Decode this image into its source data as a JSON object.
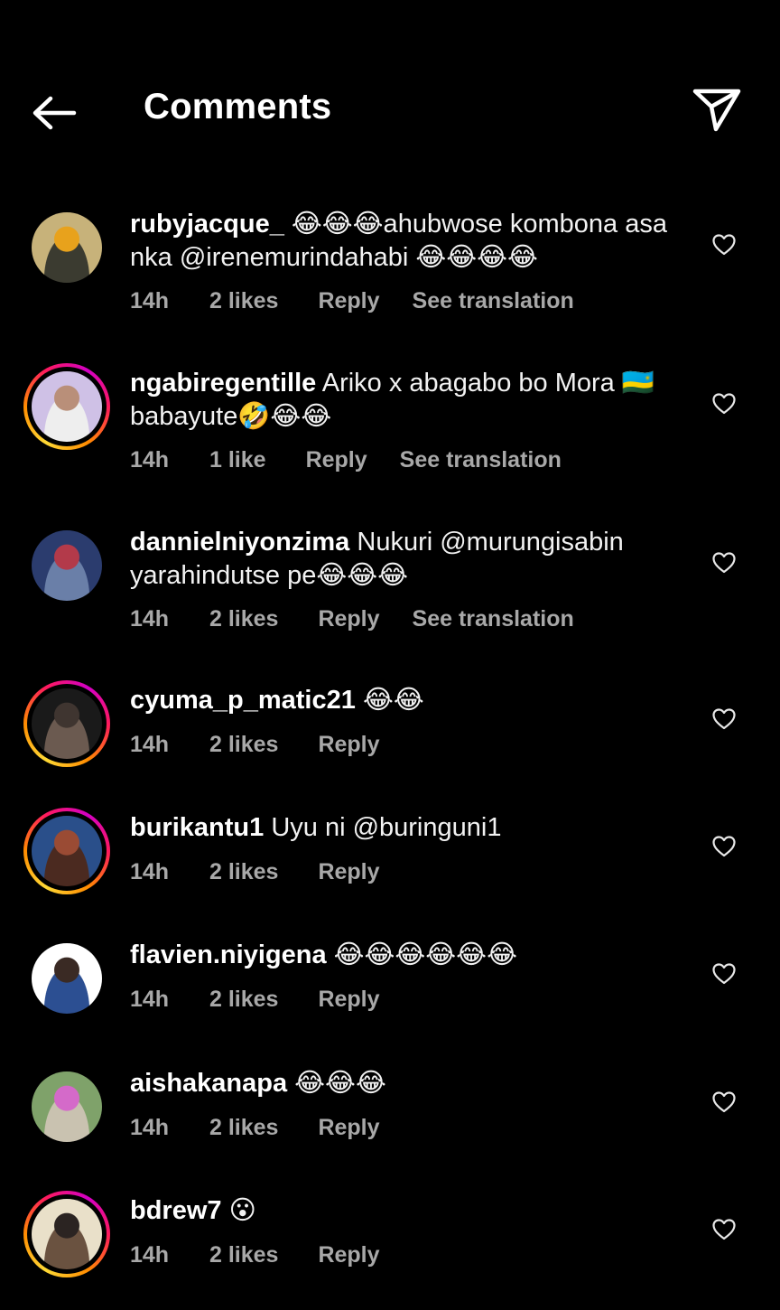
{
  "header": {
    "title": "Comments",
    "back_icon": "arrow-left-icon",
    "share_icon": "paper-plane-icon"
  },
  "comments": [
    {
      "username": "rubyjacque_",
      "text": "😂😂😂ahubwose kombona asa nka @irenemurindahabi 😂😂😂😂",
      "time": "14h",
      "likes": "2 likes",
      "reply": "Reply",
      "translate": "See translation",
      "has_story": false,
      "avatar_colors": [
        "#c7b27a",
        "#e8a21c",
        "#3b3b30"
      ]
    },
    {
      "username": "ngabiregentille",
      "text": "Ariko x abagabo bo Mora 🇷🇼 babayute🤣😂😂",
      "time": "14h",
      "likes": "1 like",
      "reply": "Reply",
      "translate": "See translation",
      "has_story": true,
      "avatar_colors": [
        "#cfc1e6",
        "#b98f79",
        "#eeeeee"
      ]
    },
    {
      "username": "dannielniyonzima",
      "text": "Nukuri @murungisabin yarahindutse pe😂😂😂",
      "time": "14h",
      "likes": "2 likes",
      "reply": "Reply",
      "translate": "See translation",
      "has_story": false,
      "avatar_colors": [
        "#2b3c6e",
        "#b33a4a",
        "#6a7fa8"
      ]
    },
    {
      "username": "cyuma_p_matic21",
      "text": "😂😂",
      "time": "14h",
      "likes": "2 likes",
      "reply": "Reply",
      "translate": "",
      "has_story": true,
      "avatar_colors": [
        "#1a1a1a",
        "#3f3530",
        "#6b5a50"
      ]
    },
    {
      "username": "burikantu1",
      "text": "Uyu ni @buringuni1",
      "time": "14h",
      "likes": "2 likes",
      "reply": "Reply",
      "translate": "",
      "has_story": true,
      "avatar_colors": [
        "#2a4f8a",
        "#9a4b34",
        "#4b2a20"
      ]
    },
    {
      "username": "flavien.niyigena",
      "text": "😂😂😂😂😂😂",
      "time": "14h",
      "likes": "2 likes",
      "reply": "Reply",
      "translate": "",
      "has_story": false,
      "avatar_colors": [
        "#ffffff",
        "#3a2a24",
        "#2c4f92"
      ]
    },
    {
      "username": "aishakanapa",
      "text": "😂😂😂",
      "time": "14h",
      "likes": "2 likes",
      "reply": "Reply",
      "translate": "",
      "has_story": false,
      "avatar_colors": [
        "#7fa26a",
        "#d46ac9",
        "#c9c2b0"
      ]
    },
    {
      "username": "bdrew7",
      "text": "😮",
      "time": "14h",
      "likes": "2 likes",
      "reply": "Reply",
      "translate": "",
      "has_story": true,
      "avatar_colors": [
        "#e9e0c9",
        "#2b2422",
        "#6a5240"
      ]
    }
  ]
}
